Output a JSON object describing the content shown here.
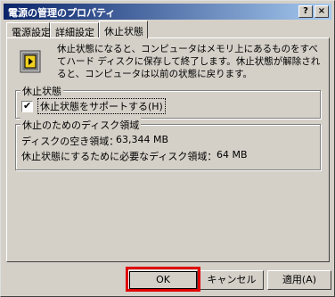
{
  "window": {
    "title": "電源の管理のプロパティ",
    "help_button": "?",
    "close_button": "×"
  },
  "tabs": [
    {
      "label": "電源設定"
    },
    {
      "label": "詳細設定"
    },
    {
      "label": "休止状態",
      "active": true
    }
  ],
  "hibernate": {
    "description": "休止状態になると、コンピュータはメモリ上にあるものをすべてハード ディスクに保存して終了します。休止状態が解除されると、コンピュータは以前の状態に戻ります。",
    "group_title": "休止状態",
    "checkbox_label": "休止状態をサポートする(H)",
    "checked": true
  },
  "disk": {
    "group_title": "休止のためのディスク領域",
    "free_label": "ディスクの空き領域：",
    "free_value": "63,344 MB",
    "required_label": "休止状態にするために必要なディスク領域：",
    "required_value": "64 MB"
  },
  "buttons": {
    "ok": "OK",
    "cancel": "キャンセル",
    "apply": "適用(A)"
  },
  "colors": {
    "highlight": "#e00000",
    "titlebar": "#0a246a"
  }
}
